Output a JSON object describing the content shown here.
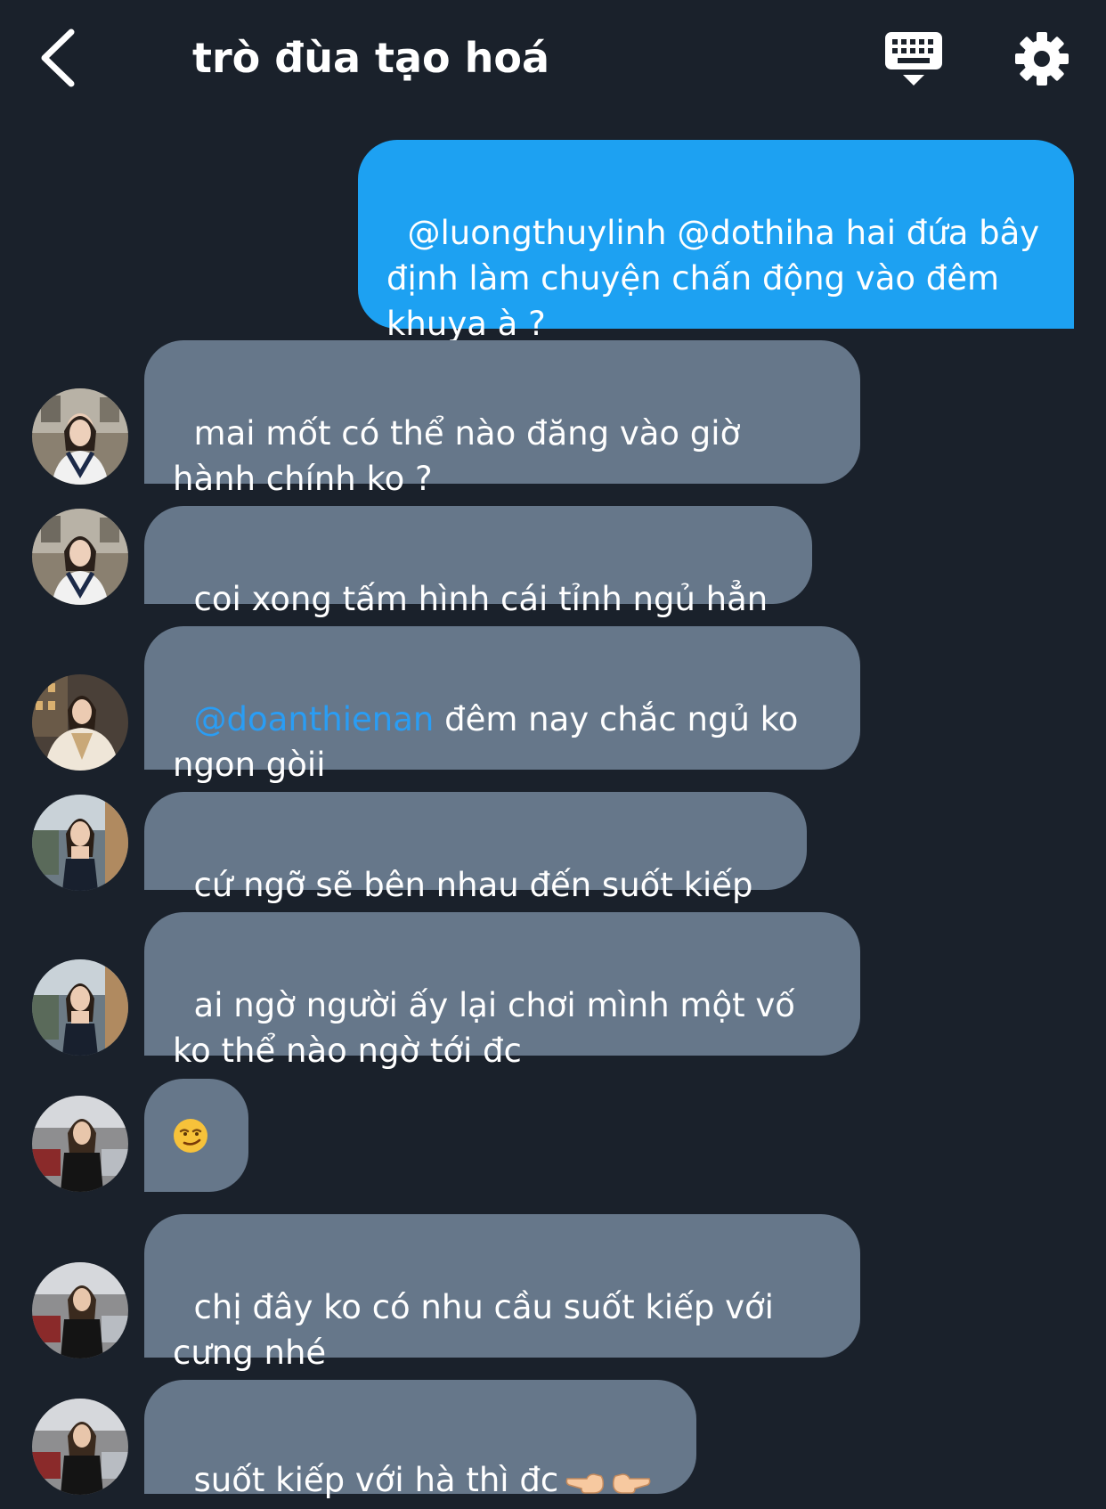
{
  "header": {
    "title": "trò đùa tạo hoá",
    "back_icon": "chevron-left-icon",
    "keyboard_icon": "keyboard-icon",
    "settings_icon": "gear-icon"
  },
  "colors": {
    "background": "#1a212b",
    "sent_bubble": "#1da1f2",
    "received_bubble": "#66778a",
    "mention": "#2a9df4"
  },
  "messages": [
    {
      "side": "sent",
      "text": "@luongthuylinh @dothiha hai đứa bây định làm chuyện chấn động vào đêm khuya à ?"
    },
    {
      "side": "received",
      "avatar": "avatar-1",
      "text": "mai mốt có thể nào đăng vào giờ hành chính ko ?"
    },
    {
      "side": "received",
      "avatar": "avatar-1",
      "text": "coi xong tấm hình cái tỉnh ngủ hẳn"
    },
    {
      "side": "received",
      "avatar": "avatar-2",
      "mention": "@doanthienan",
      "text": " đêm nay chắc ngủ ko ngon gòii"
    },
    {
      "side": "received",
      "avatar": "avatar-3",
      "text": "cứ ngỡ sẽ bên nhau đến suốt kiếp"
    },
    {
      "side": "received",
      "avatar": "avatar-3",
      "text": "ai ngờ người ấy lại chơi mình một vố ko thể nào ngờ tới đc"
    },
    {
      "side": "received",
      "avatar": "avatar-4",
      "emoji": "smirking-face-emoji"
    },
    {
      "side": "received",
      "avatar": "avatar-4",
      "text": "chị đây ko có nhu cầu suốt kiếp với cưng nhé"
    },
    {
      "side": "received",
      "avatar": "avatar-4",
      "text": "suốt kiếp với hà thì đc",
      "emoji": "pointing-hands-emoji"
    }
  ]
}
